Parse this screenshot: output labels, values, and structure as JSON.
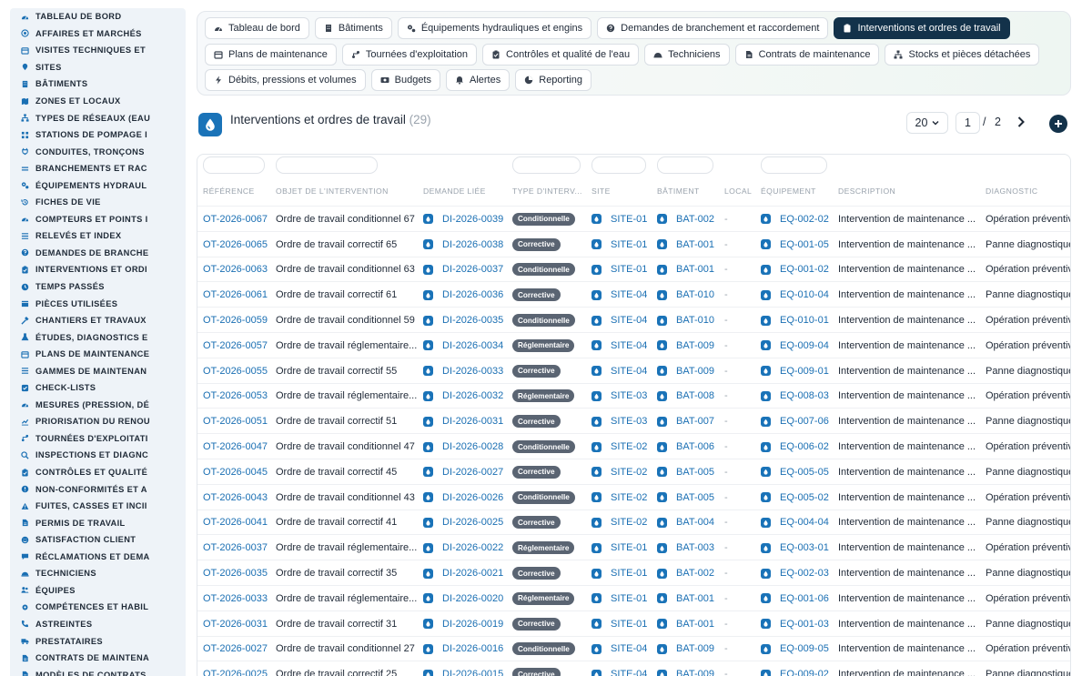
{
  "sidebar": {
    "items": [
      {
        "label": "TABLEAU DE BORD",
        "icon": "gauge-icon"
      },
      {
        "label": "AFFAIRES ET MARCHÉS",
        "icon": "target-icon"
      },
      {
        "label": "VISITES TECHNIQUES ET",
        "icon": "calendar-icon"
      },
      {
        "label": "SITES",
        "icon": "pin-icon"
      },
      {
        "label": "BÂTIMENTS",
        "icon": "building-icon"
      },
      {
        "label": "ZONES ET LOCAUX",
        "icon": "map-icon"
      },
      {
        "label": "TYPES DE RÉSEAUX (EAU",
        "icon": "network-icon"
      },
      {
        "label": "STATIONS DE POMPAGE I",
        "icon": "grid-icon"
      },
      {
        "label": "CONDUITES, TRONÇONS",
        "icon": "plug-icon"
      },
      {
        "label": "BRANCHEMENTS ET RAC",
        "icon": "lines-icon"
      },
      {
        "label": "ÉQUIPEMENTS HYDRAUL",
        "icon": "cogs-icon"
      },
      {
        "label": "FICHES DE VIE",
        "icon": "history-icon"
      },
      {
        "label": "COMPTEURS ET POINTS I",
        "icon": "gauge-icon"
      },
      {
        "label": "RELEVÉS ET INDEX",
        "icon": "list-icon"
      },
      {
        "label": "DEMANDES DE BRANCHE",
        "icon": "question-icon"
      },
      {
        "label": "INTERVENTIONS ET ORDI",
        "icon": "clipboard-icon"
      },
      {
        "label": "TEMPS PASSÉS",
        "icon": "clock-icon"
      },
      {
        "label": "PIÈCES UTILISÉES",
        "icon": "box-icon"
      },
      {
        "label": "CHANTIERS ET TRAVAUX",
        "icon": "hammer-icon"
      },
      {
        "label": "ÉTUDES, DIAGNOSTICS E",
        "icon": "flask-icon"
      },
      {
        "label": "PLANS DE MAINTENANCE",
        "icon": "calendar-icon"
      },
      {
        "label": "GAMMES DE MAINTENAN",
        "icon": "list-icon"
      },
      {
        "label": "CHECK-LISTS",
        "icon": "check-icon"
      },
      {
        "label": "MESURES (PRESSION, DÉ",
        "icon": "gauge-icon"
      },
      {
        "label": "PRIORISATION DU RENOU",
        "icon": "chart-icon"
      },
      {
        "label": "TOURNÉES D'EXPLOITATI",
        "icon": "route-icon"
      },
      {
        "label": "INSPECTIONS ET DIAGNC",
        "icon": "search-icon"
      },
      {
        "label": "CONTRÔLES ET QUALITÉ",
        "icon": "clipboard-icon"
      },
      {
        "label": "NON-CONFORMITÉS ET A",
        "icon": "alert-icon"
      },
      {
        "label": "FUITES, CASSES ET INCII",
        "icon": "warning-icon"
      },
      {
        "label": "PERMIS DE TRAVAIL",
        "icon": "file-icon"
      },
      {
        "label": "SATISFACTION CLIENT",
        "icon": "smile-icon"
      },
      {
        "label": "RÉCLAMATIONS ET DEMA",
        "icon": "comment-icon"
      },
      {
        "label": "TECHNICIENS",
        "icon": "helmet-icon"
      },
      {
        "label": "ÉQUIPES",
        "icon": "users-icon"
      },
      {
        "label": "COMPÉTENCES ET HABIL",
        "icon": "gear-icon"
      },
      {
        "label": "ASTREINTES",
        "icon": "phone-icon"
      },
      {
        "label": "PRESTATAIRES",
        "icon": "truck-icon"
      },
      {
        "label": "CONTRATS DE MAINTENA",
        "icon": "file-icon"
      },
      {
        "label": "MODÈLES DE CONTRATS",
        "icon": "file-icon"
      }
    ]
  },
  "nav": {
    "rows": [
      [
        {
          "label": "Tableau de bord",
          "icon": "gauge-icon",
          "active": false
        },
        {
          "label": "Bâtiments",
          "icon": "building-icon",
          "active": false
        },
        {
          "label": "Équipements hydrauliques et engins",
          "icon": "cogs-icon",
          "active": false
        },
        {
          "label": "Demandes de branchement et raccordement",
          "icon": "question-icon",
          "active": false
        },
        {
          "label": "Interventions et ordres de travail",
          "icon": "clipboard-icon",
          "active": true
        }
      ],
      [
        {
          "label": "Plans de maintenance",
          "icon": "calendar-icon",
          "active": false
        },
        {
          "label": "Tournées d'exploitation",
          "icon": "route-icon",
          "active": false
        },
        {
          "label": "Contrôles et qualité de l'eau",
          "icon": "clipboard-icon",
          "active": false
        },
        {
          "label": "Techniciens",
          "icon": "helmet-icon",
          "active": false
        },
        {
          "label": "Contrats de maintenance",
          "icon": "file-icon",
          "active": false
        },
        {
          "label": "Stocks et pièces détachées",
          "icon": "network-icon",
          "active": false
        }
      ],
      [
        {
          "label": "Débits, pressions et volumes",
          "icon": "bolt-icon",
          "active": false
        },
        {
          "label": "Budgets",
          "icon": "money-icon",
          "active": false
        },
        {
          "label": "Alertes",
          "icon": "bell-icon",
          "active": false
        },
        {
          "label": "Reporting",
          "icon": "pie-icon",
          "active": false
        }
      ]
    ]
  },
  "header": {
    "title": "Interventions et ordres de travail",
    "count": "(29)",
    "page_size": "20",
    "current_page": "1",
    "separator": "/",
    "total_pages": "2"
  },
  "table": {
    "columns": [
      "RÉFÉRENCE",
      "OBJET DE L'INTERVENTION",
      "DEMANDE LIÉE",
      "TYPE D'INTERV...",
      "SITE",
      "BÂTIMENT",
      "LOCAL",
      "ÉQUIPEMENT",
      "DESCRIPTION",
      "DIAGNOSTIC"
    ],
    "rows": [
      [
        "OT-2026-0067",
        "Ordre de travail conditionnel 67",
        "DI-2026-0039",
        "Conditionnelle",
        "SITE-01",
        "BAT-002",
        "-",
        "EQ-002-02",
        "Intervention de maintenance ...",
        "Opération préventive"
      ],
      [
        "OT-2026-0065",
        "Ordre de travail correctif 65",
        "DI-2026-0038",
        "Corrective",
        "SITE-01",
        "BAT-001",
        "-",
        "EQ-001-05",
        "Intervention de maintenance ...",
        "Panne diagnostiquée"
      ],
      [
        "OT-2026-0063",
        "Ordre de travail conditionnel 63",
        "DI-2026-0037",
        "Conditionnelle",
        "SITE-01",
        "BAT-001",
        "-",
        "EQ-001-02",
        "Intervention de maintenance ...",
        "Opération préventive"
      ],
      [
        "OT-2026-0061",
        "Ordre de travail correctif 61",
        "DI-2026-0036",
        "Corrective",
        "SITE-04",
        "BAT-010",
        "-",
        "EQ-010-04",
        "Intervention de maintenance ...",
        "Panne diagnostiquée"
      ],
      [
        "OT-2026-0059",
        "Ordre de travail conditionnel 59",
        "DI-2026-0035",
        "Conditionnelle",
        "SITE-04",
        "BAT-010",
        "-",
        "EQ-010-01",
        "Intervention de maintenance ...",
        "Opération préventive"
      ],
      [
        "OT-2026-0057",
        "Ordre de travail réglementaire...",
        "DI-2026-0034",
        "Réglementaire",
        "SITE-04",
        "BAT-009",
        "-",
        "EQ-009-04",
        "Intervention de maintenance ...",
        "Opération préventive"
      ],
      [
        "OT-2026-0055",
        "Ordre de travail correctif 55",
        "DI-2026-0033",
        "Corrective",
        "SITE-04",
        "BAT-009",
        "-",
        "EQ-009-01",
        "Intervention de maintenance ...",
        "Panne diagnostiquée"
      ],
      [
        "OT-2026-0053",
        "Ordre de travail réglementaire...",
        "DI-2026-0032",
        "Réglementaire",
        "SITE-03",
        "BAT-008",
        "-",
        "EQ-008-03",
        "Intervention de maintenance ...",
        "Opération préventive"
      ],
      [
        "OT-2026-0051",
        "Ordre de travail correctif 51",
        "DI-2026-0031",
        "Corrective",
        "SITE-03",
        "BAT-007",
        "-",
        "EQ-007-06",
        "Intervention de maintenance ...",
        "Panne diagnostiquée"
      ],
      [
        "OT-2026-0047",
        "Ordre de travail conditionnel 47",
        "DI-2026-0028",
        "Conditionnelle",
        "SITE-02",
        "BAT-006",
        "-",
        "EQ-006-02",
        "Intervention de maintenance ...",
        "Opération préventive"
      ],
      [
        "OT-2026-0045",
        "Ordre de travail correctif 45",
        "DI-2026-0027",
        "Corrective",
        "SITE-02",
        "BAT-005",
        "-",
        "EQ-005-05",
        "Intervention de maintenance ...",
        "Panne diagnostiquée"
      ],
      [
        "OT-2026-0043",
        "Ordre de travail conditionnel 43",
        "DI-2026-0026",
        "Conditionnelle",
        "SITE-02",
        "BAT-005",
        "-",
        "EQ-005-02",
        "Intervention de maintenance ...",
        "Opération préventive"
      ],
      [
        "OT-2026-0041",
        "Ordre de travail correctif 41",
        "DI-2026-0025",
        "Corrective",
        "SITE-02",
        "BAT-004",
        "-",
        "EQ-004-04",
        "Intervention de maintenance ...",
        "Panne diagnostiquée"
      ],
      [
        "OT-2026-0037",
        "Ordre de travail réglementaire...",
        "DI-2026-0022",
        "Réglementaire",
        "SITE-01",
        "BAT-003",
        "-",
        "EQ-003-01",
        "Intervention de maintenance ...",
        "Opération préventive"
      ],
      [
        "OT-2026-0035",
        "Ordre de travail correctif 35",
        "DI-2026-0021",
        "Corrective",
        "SITE-01",
        "BAT-002",
        "-",
        "EQ-002-03",
        "Intervention de maintenance ...",
        "Panne diagnostiquée"
      ],
      [
        "OT-2026-0033",
        "Ordre de travail réglementaire...",
        "DI-2026-0020",
        "Réglementaire",
        "SITE-01",
        "BAT-001",
        "-",
        "EQ-001-06",
        "Intervention de maintenance ...",
        "Opération préventive"
      ],
      [
        "OT-2026-0031",
        "Ordre de travail correctif 31",
        "DI-2026-0019",
        "Corrective",
        "SITE-01",
        "BAT-001",
        "-",
        "EQ-001-03",
        "Intervention de maintenance ...",
        "Panne diagnostiquée"
      ],
      [
        "OT-2026-0027",
        "Ordre de travail conditionnel 27",
        "DI-2026-0016",
        "Conditionnelle",
        "SITE-04",
        "BAT-009",
        "-",
        "EQ-009-05",
        "Intervention de maintenance ...",
        "Opération préventive"
      ],
      [
        "OT-2026-0025",
        "Ordre de travail correctif 25",
        "DI-2026-0015",
        "Corrective",
        "SITE-04",
        "BAT-009",
        "-",
        "EQ-009-02",
        "Intervention de maintenance ...",
        "Panne diagnostiquée"
      ]
    ]
  },
  "colors": {
    "accent": "#1a6fb3",
    "nav_active": "#13324a",
    "badge": "#5a6472",
    "sidebar_bg": "#eef3f8"
  }
}
